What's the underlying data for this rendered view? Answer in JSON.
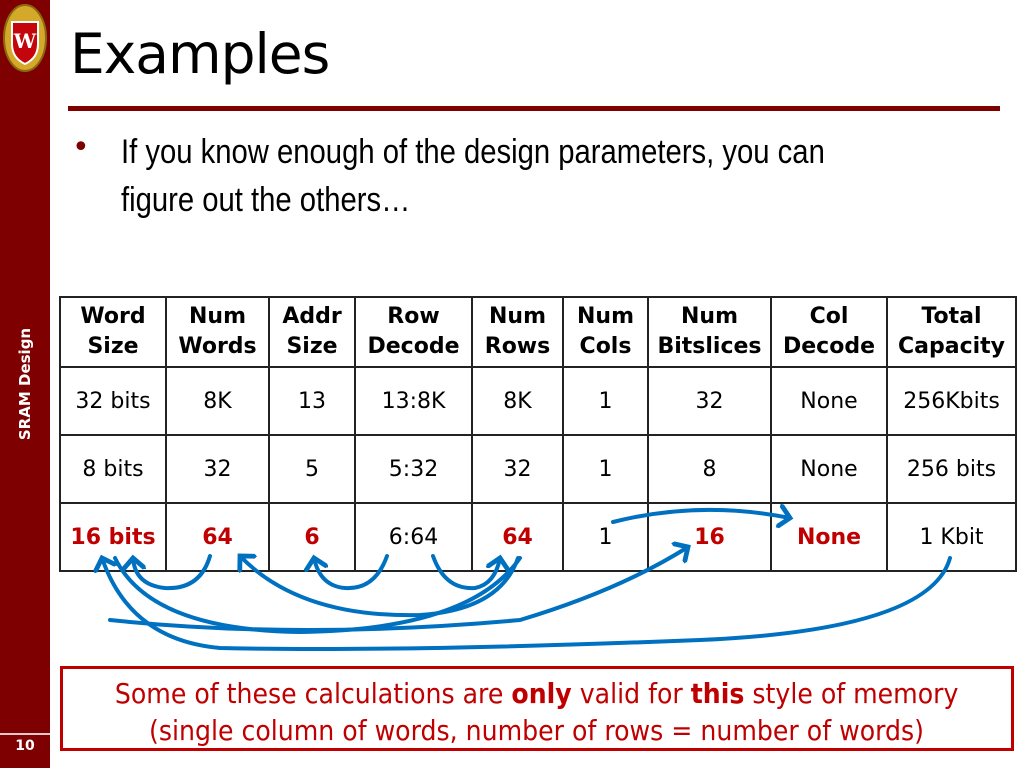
{
  "sidebar": {
    "logo": "uw-crest-logo",
    "label": "SRAM Design",
    "page_number": "10"
  },
  "slide": {
    "title": "Examples",
    "bullet": "•",
    "bullet_text": "If you know enough of the design parameters, you can figure out the others…"
  },
  "table": {
    "headers": [
      [
        "Word",
        "Size"
      ],
      [
        "Num",
        "Words"
      ],
      [
        "Addr",
        "Size"
      ],
      [
        "Row",
        "Decode"
      ],
      [
        "Num",
        "Rows"
      ],
      [
        "Num",
        "Cols"
      ],
      [
        "Num",
        "Bitslices"
      ],
      [
        "Col",
        "Decode"
      ],
      [
        "Total",
        "Capacity"
      ]
    ],
    "rows": [
      [
        "32 bits",
        "8K",
        "13",
        "13:8K",
        "8K",
        "1",
        "32",
        "None",
        "256Kbits"
      ],
      [
        "8 bits",
        "32",
        "5",
        "5:32",
        "32",
        "1",
        "8",
        "None",
        "256 bits"
      ],
      [
        "16 bits",
        "64",
        "6",
        "6:64",
        "64",
        "1",
        "16",
        "None",
        "1 Kbit"
      ]
    ],
    "highlighted_cells_row3": [
      "16 bits",
      "64",
      "6",
      "64",
      "16",
      "None"
    ],
    "highlight_color": "#c00000"
  },
  "arrows": {
    "color": "#0070c0",
    "relations": [
      {
        "from": "Num Words",
        "to": "Word Size"
      },
      {
        "from": "Total Capacity",
        "to": "Word Size"
      },
      {
        "from": "Num Rows",
        "to": "Word Size"
      },
      {
        "from": "Num Rows",
        "to": "Num Words"
      },
      {
        "from": "Row Decode",
        "to": "Addr Size"
      },
      {
        "from": "Row Decode",
        "to": "Num Rows"
      },
      {
        "from": "Word Size",
        "to": "Num Bitslices"
      },
      {
        "from": "Num Cols",
        "to": "Col Decode"
      }
    ]
  },
  "note": {
    "line1_pre": "Some of these calculations are ",
    "line1_b1": "only",
    "line1_mid": " valid for ",
    "line1_b2": "this",
    "line1_post": " style of memory",
    "line2": "(single column of words, number of rows = number of words)"
  }
}
